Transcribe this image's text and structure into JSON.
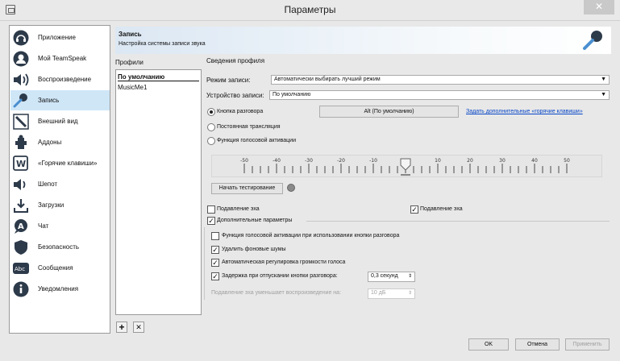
{
  "window": {
    "title": "Параметры",
    "close": "✕"
  },
  "sidebar": {
    "items": [
      {
        "label": "Приложение",
        "icon": "application-icon"
      },
      {
        "label": "Мой TeamSpeak",
        "icon": "user-icon"
      },
      {
        "label": "Воспроизведение",
        "icon": "speaker-icon"
      },
      {
        "label": "Запись",
        "icon": "microphone-icon",
        "active": true
      },
      {
        "label": "Внешний вид",
        "icon": "design-icon"
      },
      {
        "label": "Аддоны",
        "icon": "puzzle-icon"
      },
      {
        "label": "«Горячие клавиши»",
        "icon": "hotkey-icon"
      },
      {
        "label": "Шепот",
        "icon": "whisper-icon"
      },
      {
        "label": "Загрузки",
        "icon": "download-icon"
      },
      {
        "label": "Чат",
        "icon": "chat-icon"
      },
      {
        "label": "Безопасность",
        "icon": "shield-icon"
      },
      {
        "label": "Сообщения",
        "icon": "messages-icon"
      },
      {
        "label": "Уведомления",
        "icon": "info-icon"
      }
    ]
  },
  "header": {
    "title": "Запись",
    "subtitle": "Настройка системы записи звука"
  },
  "profiles": {
    "label": "Профили",
    "items": [
      "По умолчанию",
      "MusicMe1"
    ],
    "add": "+",
    "remove": "✕"
  },
  "details": {
    "section_label": "Сведения профиля",
    "mode_label": "Режим записи:",
    "mode_value": "Автоматически выбирать лучший режим",
    "device_label": "Устройство записи:",
    "device_value": "По умолчанию",
    "radio_ptt": "Кнопка разговора",
    "ptt_key": "Alt (По умолчанию)",
    "hotkeys_link": "Задать дополнительные «горячие клавиши»",
    "radio_continuous": "Постоянная трансляция",
    "radio_vad": "Функция голосовой активации",
    "slider_ticks": [
      "-50",
      "-40",
      "-30",
      "-20",
      "-10",
      "0",
      "10",
      "20",
      "30",
      "40",
      "50"
    ],
    "slider_value": 0,
    "test_button": "Начать тестирование",
    "echo_suppression": "Подавление эха",
    "echo_cancellation": "Подавление эха",
    "advanced": "Дополнительные параметры",
    "opt_vad_ptt": "Функция голосовой активации при использовании кнопки разговора",
    "opt_noise": "Удалить фоновые шумы",
    "opt_agc": "Автоматическая регулировка громкости голоса",
    "opt_delay": "Задержка при отпускании кнопки разговора:",
    "delay_value": "0,3 секунд",
    "echo_reduce_label": "Подавление эха уменьшает воспроизведение на:",
    "echo_reduce_value": "10 дБ"
  },
  "footer": {
    "ok": "OK",
    "cancel": "Отмена",
    "apply": "Применить"
  }
}
